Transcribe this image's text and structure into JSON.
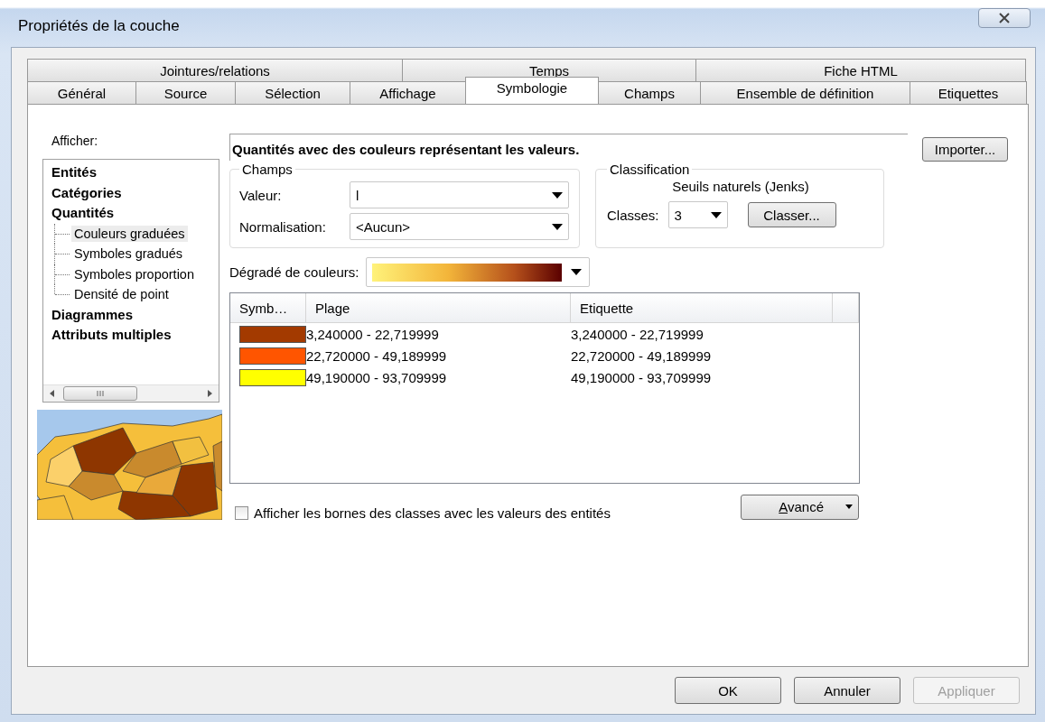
{
  "window": {
    "title": "Propriétés de la couche"
  },
  "tab_rows": [
    [
      {
        "label": "Jointures/relations",
        "selected": false
      },
      {
        "label": "Temps",
        "selected": false
      },
      {
        "label": "Fiche HTML",
        "selected": false
      }
    ],
    [
      {
        "label": "Général",
        "selected": false
      },
      {
        "label": "Source",
        "selected": false
      },
      {
        "label": "Sélection",
        "selected": false
      },
      {
        "label": "Affichage",
        "selected": false
      },
      {
        "label": "Symbologie",
        "selected": true
      },
      {
        "label": "Champs",
        "selected": false
      },
      {
        "label": "Ensemble de définition",
        "selected": false
      },
      {
        "label": "Etiquettes",
        "selected": false
      }
    ]
  ],
  "show": {
    "label": "Afficher:",
    "tree": [
      {
        "label": "Entités"
      },
      {
        "label": "Catégories"
      },
      {
        "label": "Quantités",
        "children": [
          {
            "label": "Couleurs graduées",
            "selected": true
          },
          {
            "label": "Symboles gradués",
            "selected": false
          },
          {
            "label": "Symboles proportion",
            "selected": false
          },
          {
            "label": "Densité de point",
            "selected": false
          }
        ]
      },
      {
        "label": "Diagrammes"
      },
      {
        "label": "Attributs multiples"
      }
    ]
  },
  "description": "Quantités avec des couleurs représentant les valeurs.",
  "import_button": "Importer...",
  "fields_group": {
    "title": "Champs",
    "rows": [
      {
        "label": "Valeur:",
        "value": "l"
      },
      {
        "label": "Normalisation:",
        "value": "<Aucun>"
      }
    ]
  },
  "classification": {
    "title": "Classification",
    "method": "Seuils naturels (Jenks)",
    "classes_label": "Classes:",
    "classes_value": "3",
    "classify_button": "Classer..."
  },
  "color_ramp": {
    "label": "Dégradé de couleurs:"
  },
  "table": {
    "columns": [
      "Symb…",
      "Plage",
      "Etiquette"
    ],
    "rows": [
      {
        "color": "#a33a00",
        "range": "3,240000 - 22,719999",
        "label": "3,240000 - 22,719999"
      },
      {
        "color": "#ff5500",
        "range": "22,720000 - 49,189999",
        "label": "22,720000 - 49,189999"
      },
      {
        "color": "#ffff00",
        "range": "49,190000 - 93,709999",
        "label": "49,190000 - 93,709999"
      }
    ]
  },
  "show_class_breaks": {
    "label": "Afficher les bornes des classes avec les valeurs des entités",
    "checked": false
  },
  "advanced_button": "Avancé",
  "buttons": [
    {
      "label": "OK",
      "disabled": false
    },
    {
      "label": "Annuler",
      "disabled": false
    },
    {
      "label": "Appliquer",
      "disabled": true
    }
  ]
}
